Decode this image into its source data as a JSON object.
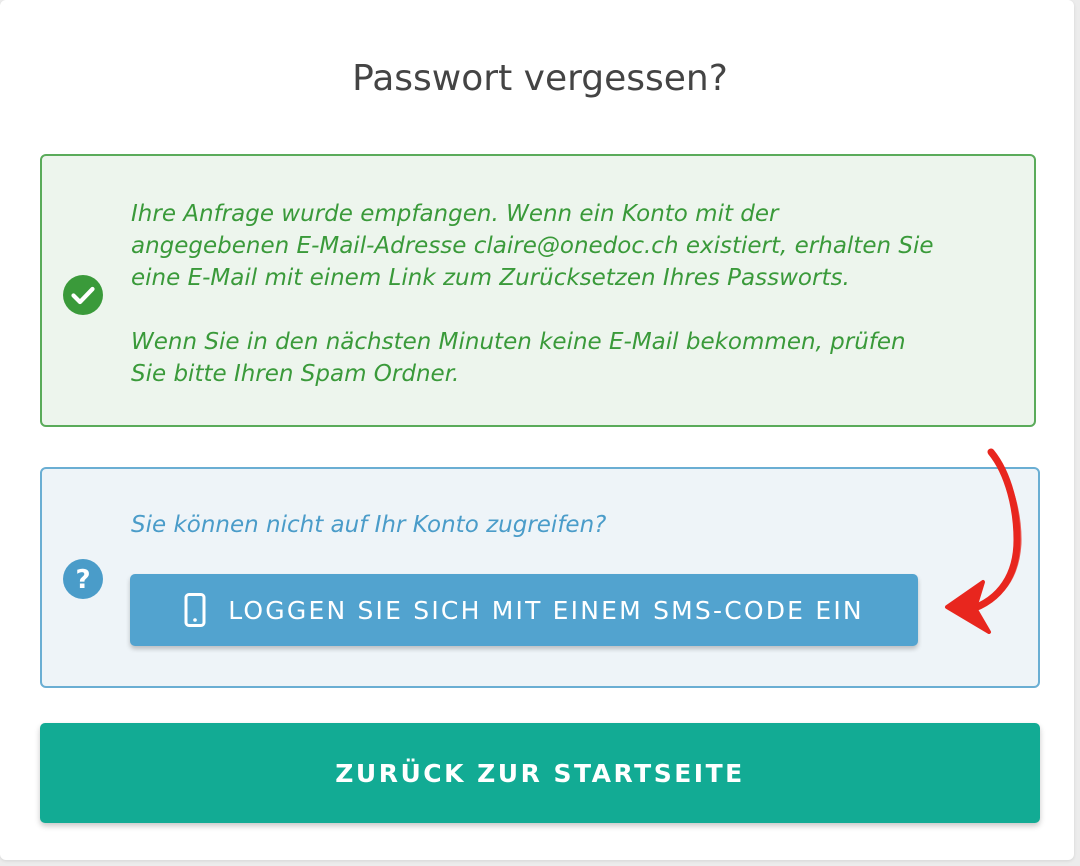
{
  "page": {
    "title": "Passwort vergessen?"
  },
  "success_alert": {
    "icon": "check-circle-icon",
    "color": "#3a9a3a",
    "paragraph1": "Ihre Anfrage wurde empfangen. Wenn ein Konto mit der\nangegebenen E-Mail-Adresse claire@onedoc.ch existiert, erhalten Sie\neine E-Mail mit einem Link zum Zurücksetzen Ihres Passworts.",
    "paragraph2": "Wenn Sie in den nächsten Minuten keine E-Mail bekommen, prüfen\nSie bitte Ihren Spam Ordner."
  },
  "info_alert": {
    "icon": "question-circle-icon",
    "color": "#4a9cc9",
    "text": "Sie können nicht auf Ihr Konto zugreifen?",
    "sms_button": {
      "icon": "mobile-phone-icon",
      "label": "LOGGEN SIE SICH MIT EINEM SMS-CODE EIN",
      "color": "#52a3cf"
    }
  },
  "annotation": {
    "icon": "red-arrow-annotation",
    "color": "#e8261e"
  },
  "back_button": {
    "label": "ZURÜCK ZUR STARTSEITE",
    "color": "#12ab94"
  }
}
